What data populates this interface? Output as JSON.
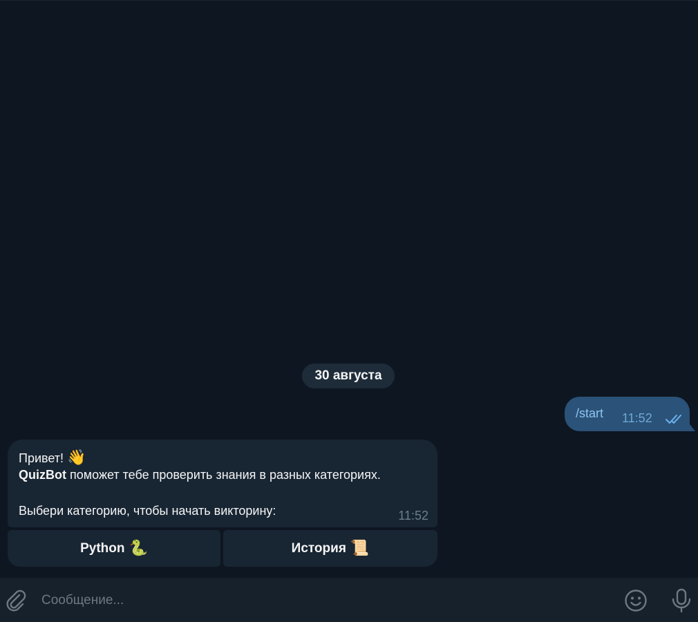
{
  "date_separator": "30 августа",
  "outgoing": {
    "text": "/start",
    "time": "11:52",
    "status_icon": "double-check-icon"
  },
  "incoming": {
    "line1_text": "Привет!",
    "line1_emoji": "👋",
    "line2_bold": "QuizBot",
    "line2_rest": " поможет тебе проверить знания в разных категориях.",
    "line3": "Выбери категорию, чтобы начать викторину:",
    "time": "11:52"
  },
  "keyboard": [
    {
      "label": "Python",
      "emoji": "🐍"
    },
    {
      "label": "История",
      "emoji": "📜"
    }
  ],
  "composer": {
    "placeholder": "Сообщение...",
    "attach_icon": "paperclip-icon",
    "emoji_icon": "smiley-icon",
    "mic_icon": "microphone-icon"
  },
  "colors": {
    "background": "#0e1621",
    "outgoing_bubble": "#2b5278",
    "incoming_bubble": "#182533",
    "composer": "#17212b"
  }
}
